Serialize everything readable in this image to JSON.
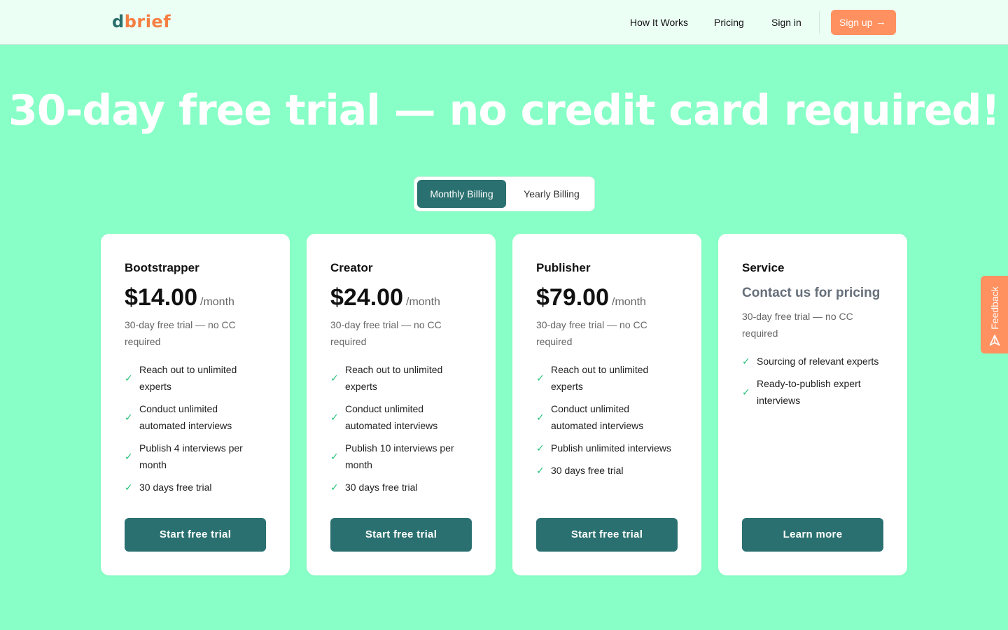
{
  "header": {
    "logo_first": "d",
    "logo_rest": "brief",
    "nav": [
      "How It Works",
      "Pricing",
      "Sign in"
    ],
    "signup_label": "Sign up",
    "signup_arrow": "→"
  },
  "hero": {
    "title": "30-day free trial — no credit card required!"
  },
  "billing_toggle": {
    "active": "Monthly Billing",
    "inactive": "Yearly Billing"
  },
  "plans": [
    {
      "name": "Bootstrapper",
      "price": "$14.00",
      "period": "/month",
      "trial_note": "30-day free trial — no CC required",
      "features": [
        "Reach out to unlimited experts",
        "Conduct unlimited automated interviews",
        "Publish 4 interviews per month",
        "30 days free trial"
      ],
      "cta": "Start free trial"
    },
    {
      "name": "Creator",
      "price": "$24.00",
      "period": "/month",
      "trial_note": "30-day free trial — no CC required",
      "features": [
        "Reach out to unlimited experts",
        "Conduct unlimited automated interviews",
        "Publish 10 interviews per month",
        "30 days free trial"
      ],
      "cta": "Start free trial"
    },
    {
      "name": "Publisher",
      "price": "$79.00",
      "period": "/month",
      "trial_note": "30-day free trial — no CC required",
      "features": [
        "Reach out to unlimited experts",
        "Conduct unlimited automated interviews",
        "Publish unlimited interviews",
        "30 days free trial"
      ],
      "cta": "Start free trial"
    },
    {
      "name": "Service",
      "contact": "Contact us for pricing",
      "trial_note": "30-day free trial — no CC required",
      "features": [
        "Sourcing of relevant experts",
        "Ready-to-publish expert interviews"
      ],
      "cta": "Learn more"
    }
  ],
  "feedback": {
    "label": "Feedback",
    "icon": "paper-plane-icon"
  },
  "check_glyph": "✓",
  "colors": {
    "background": "#87ffc6",
    "header_bg": "#ecfff5",
    "primary": "#2b7070",
    "accent": "#ff9160",
    "check": "#27c27a"
  }
}
